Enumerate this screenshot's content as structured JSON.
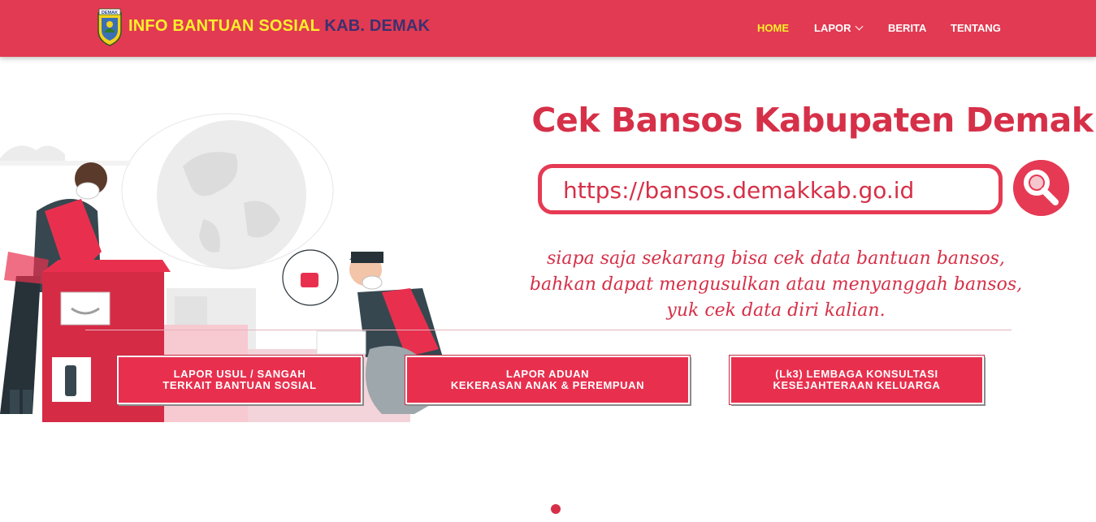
{
  "navbar": {
    "brand_part1": "INFO BANTUAN SOSIAL",
    "brand_part2": "KAB. DEMAK",
    "logo_text": "DEMAK",
    "items": [
      {
        "label": "HOME",
        "active": true
      },
      {
        "label": "LAPOR",
        "has_dropdown": true
      },
      {
        "label": "BERITA"
      },
      {
        "label": "TENTANG"
      }
    ]
  },
  "hero": {
    "title": "Cek Bansos Kabupaten Demak",
    "url": "https://bansos.demakkab.go.id",
    "description_lines": [
      "siapa saja sekarang bisa cek data bantuan bansos,",
      "bahkan dapat mengusulkan atau menyanggah bansos,",
      "yuk cek data diri kalian."
    ]
  },
  "buttons": [
    {
      "line1": "LAPOR USUL / SANGAH",
      "line2": "TERKAIT BANTUAN SOSIAL"
    },
    {
      "line1": "LAPOR ADUAN",
      "line2": "KEKERASAN ANAK & PEREMPUAN"
    },
    {
      "line1": "(Lk3) LEMBAGA KONSULTASI",
      "line2": "KESEJAHTERAAN KELUARGA"
    }
  ],
  "colors": {
    "brand_red": "#e23a52",
    "accent_yellow": "#f9f02a",
    "brand_navy": "#3a3170",
    "text_red": "#d63048"
  },
  "icons": [
    "demak-crest-icon",
    "chevron-down-icon",
    "search-icon",
    "thumbs-up-icon"
  ]
}
